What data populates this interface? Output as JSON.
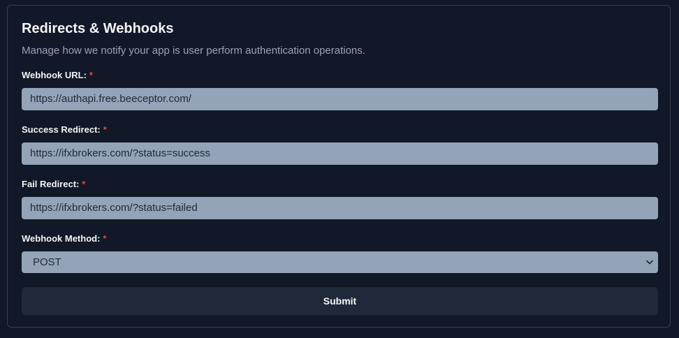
{
  "card": {
    "title": "Redirects & Webhooks",
    "subtitle": "Manage how we notify your app is user perform authentication operations."
  },
  "fields": {
    "webhook_url": {
      "label": "Webhook URL:",
      "required_mark": "*",
      "value": "https://authapi.free.beeceptor.com/"
    },
    "success_redirect": {
      "label": "Success Redirect:",
      "required_mark": "*",
      "value": "https://ifxbrokers.com/?status=success"
    },
    "fail_redirect": {
      "label": "Fail Redirect:",
      "required_mark": "*",
      "value": "https://ifxbrokers.com/?status=failed"
    },
    "webhook_method": {
      "label": "Webhook Method:",
      "required_mark": "*",
      "selected": "POST",
      "icon": "chevron-down-icon"
    }
  },
  "submit": {
    "label": "Submit"
  },
  "colors": {
    "background": "#111827",
    "input_bg": "#94a3b8",
    "required": "#ef4444",
    "button_bg": "#1f2937"
  }
}
